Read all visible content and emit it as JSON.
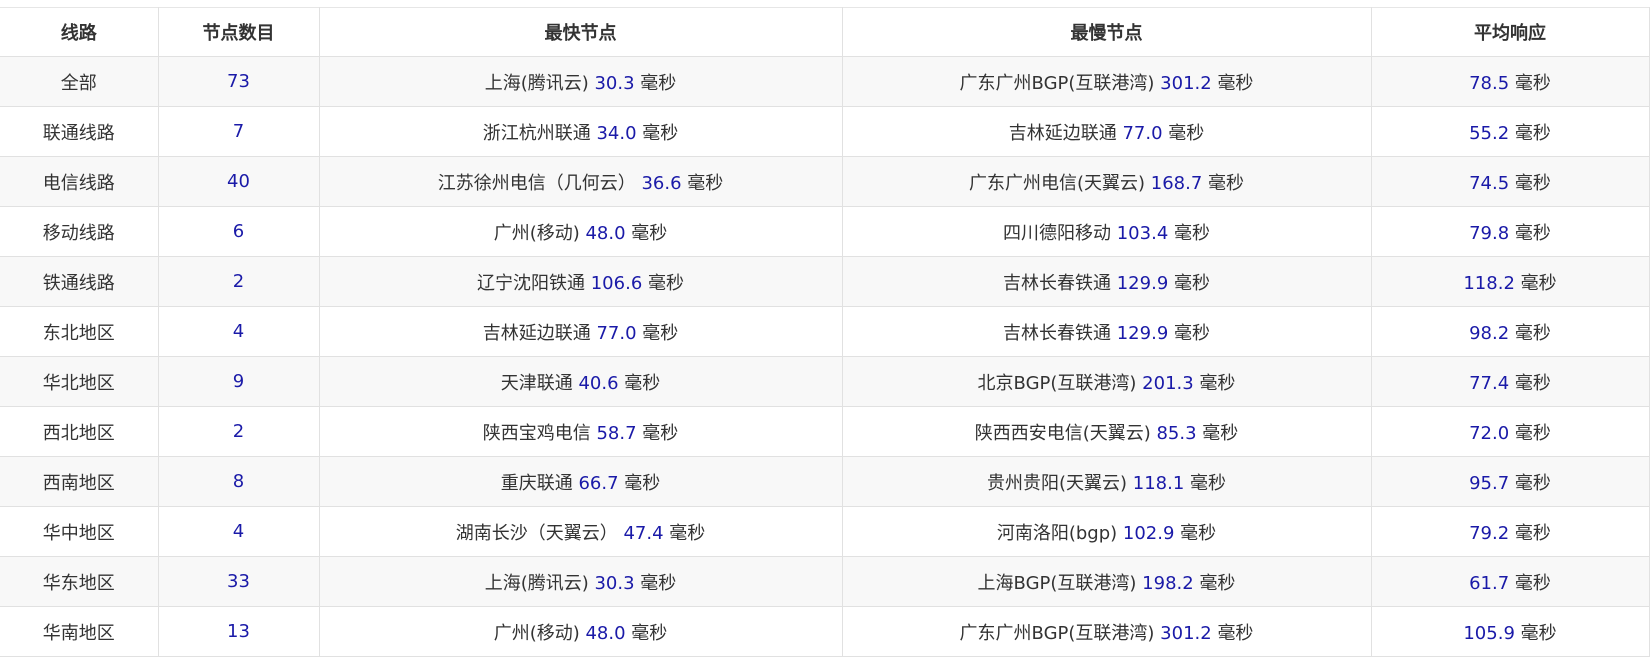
{
  "table": {
    "headers": [
      "线路",
      "节点数目",
      "最快节点",
      "最慢节点",
      "平均响应"
    ],
    "unit": "毫秒",
    "rows": [
      {
        "line": "全部",
        "count": "73",
        "fast_name": "上海(腾讯云)",
        "fast_ms": "30.3",
        "slow_name": "广东广州BGP(互联港湾)",
        "slow_ms": "301.2",
        "avg_ms": "78.5"
      },
      {
        "line": "联通线路",
        "count": "7",
        "fast_name": "浙江杭州联通",
        "fast_ms": "34.0",
        "slow_name": "吉林延边联通",
        "slow_ms": "77.0",
        "avg_ms": "55.2"
      },
      {
        "line": "电信线路",
        "count": "40",
        "fast_name": "江苏徐州电信（几何云）",
        "fast_ms": "36.6",
        "slow_name": "广东广州电信(天翼云)",
        "slow_ms": "168.7",
        "avg_ms": "74.5"
      },
      {
        "line": "移动线路",
        "count": "6",
        "fast_name": "广州(移动)",
        "fast_ms": "48.0",
        "slow_name": "四川德阳移动",
        "slow_ms": "103.4",
        "avg_ms": "79.8"
      },
      {
        "line": "铁通线路",
        "count": "2",
        "fast_name": "辽宁沈阳铁通",
        "fast_ms": "106.6",
        "slow_name": "吉林长春铁通",
        "slow_ms": "129.9",
        "avg_ms": "118.2"
      },
      {
        "line": "东北地区",
        "count": "4",
        "fast_name": "吉林延边联通",
        "fast_ms": "77.0",
        "slow_name": "吉林长春铁通",
        "slow_ms": "129.9",
        "avg_ms": "98.2"
      },
      {
        "line": "华北地区",
        "count": "9",
        "fast_name": "天津联通",
        "fast_ms": "40.6",
        "slow_name": "北京BGP(互联港湾)",
        "slow_ms": "201.3",
        "avg_ms": "77.4"
      },
      {
        "line": "西北地区",
        "count": "2",
        "fast_name": "陕西宝鸡电信",
        "fast_ms": "58.7",
        "slow_name": "陕西西安电信(天翼云)",
        "slow_ms": "85.3",
        "avg_ms": "72.0"
      },
      {
        "line": "西南地区",
        "count": "8",
        "fast_name": "重庆联通",
        "fast_ms": "66.7",
        "slow_name": "贵州贵阳(天翼云)",
        "slow_ms": "118.1",
        "avg_ms": "95.7"
      },
      {
        "line": "华中地区",
        "count": "4",
        "fast_name": "湖南长沙（天翼云）",
        "fast_ms": "47.4",
        "slow_name": "河南洛阳(bgp)",
        "slow_ms": "102.9",
        "avg_ms": "79.2"
      },
      {
        "line": "华东地区",
        "count": "33",
        "fast_name": "上海(腾讯云)",
        "fast_ms": "30.3",
        "slow_name": "上海BGP(互联港湾)",
        "slow_ms": "198.2",
        "avg_ms": "61.7"
      },
      {
        "line": "华南地区",
        "count": "13",
        "fast_name": "广州(移动)",
        "fast_ms": "48.0",
        "slow_name": "广东广州BGP(互联港湾)",
        "slow_ms": "301.2",
        "avg_ms": "105.9"
      }
    ]
  },
  "colors": {
    "value_blue": "#1a1aa8",
    "text": "#333333",
    "stripe": "#f8f8f8",
    "border": "#e1e1e1"
  }
}
